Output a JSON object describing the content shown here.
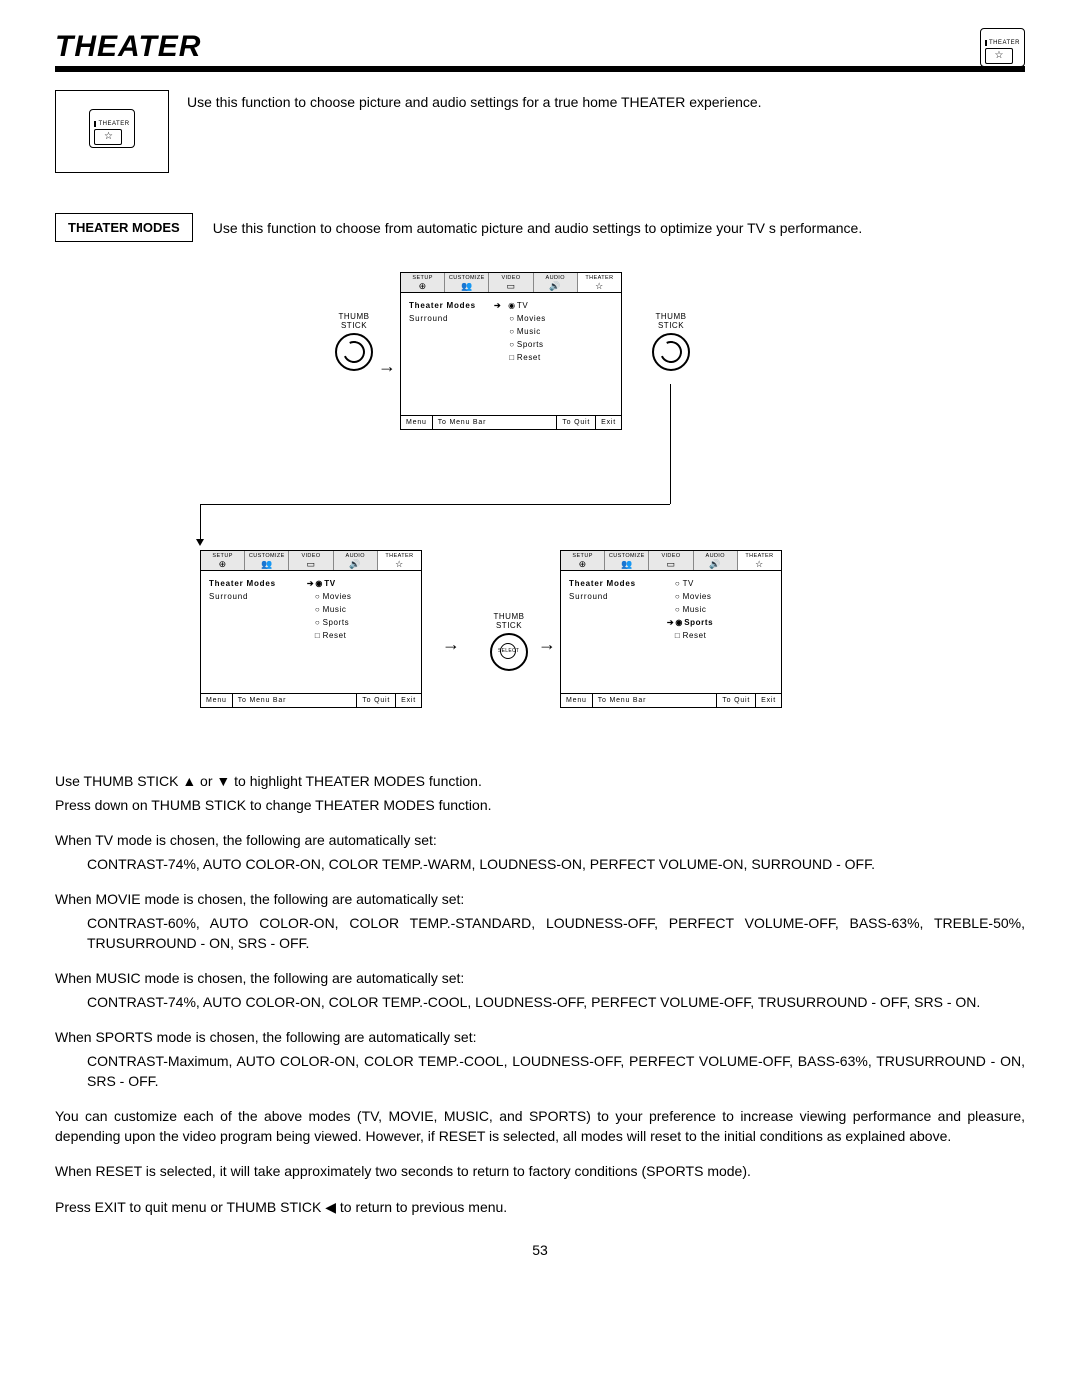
{
  "page_number": "53",
  "title": "THEATER",
  "corner_icon_label": "THEATER",
  "intro_text": "Use this function to choose picture and audio settings for a true home THEATER experience.",
  "section_label": "THEATER MODES",
  "section_text": "Use this function to choose from automatic picture and audio settings to optimize your TV s performance.",
  "thumbstick_label": "THUMB\nSTICK",
  "select_label": "SELECT",
  "tabs": [
    "SETUP",
    "CUSTOMIZE",
    "VIDEO",
    "AUDIO",
    "THEATER"
  ],
  "tab_icons": [
    "⊕",
    "👥",
    "▭",
    "🔊",
    "☆"
  ],
  "menu_left": {
    "item1": "Theater Modes",
    "item2": "Surround"
  },
  "options": {
    "tv": "TV",
    "movies": "Movies",
    "music": "Music",
    "sports": "Sports",
    "reset": "Reset"
  },
  "footer": {
    "menu": "Menu",
    "to_menu_bar": "To Menu Bar",
    "to_quit": "To Quit",
    "exit": "Exit"
  },
  "body": {
    "p1": "Use THUMB STICK ▲ or ▼ to highlight THEATER  MODES function.",
    "p2": "Press down on THUMB STICK to change THEATER MODES function.",
    "tv_head": "When TV mode is chosen, the following are automatically set:",
    "tv_body": "CONTRAST-74%, AUTO COLOR-ON, COLOR TEMP.-WARM, LOUDNESS-ON, PERFECT VOLUME-ON, SURROUND - OFF.",
    "movie_head": "When MOVIE mode is chosen, the following are automatically set:",
    "movie_body": "CONTRAST-60%, AUTO COLOR-ON, COLOR TEMP.-STANDARD, LOUDNESS-OFF, PERFECT VOLUME-OFF, BASS-63%, TREBLE-50%, TRUSURROUND - ON, SRS - OFF.",
    "music_head": "When MUSIC mode is chosen, the following are automatically set:",
    "music_body": "CONTRAST-74%, AUTO COLOR-ON, COLOR TEMP.-COOL, LOUDNESS-OFF, PERFECT VOLUME-OFF, TRUSURROUND - OFF, SRS - ON.",
    "sports_head": "When SPORTS mode is chosen, the following are automatically set:",
    "sports_body": "CONTRAST-Maximum, AUTO COLOR-ON, COLOR TEMP.-COOL, LOUDNESS-OFF, PERFECT VOLUME-OFF, BASS-63%, TRUSURROUND - ON, SRS - OFF.",
    "customize": "You can customize each of the above modes (TV, MOVIE, MUSIC, and SPORTS) to your preference to increase viewing performance and pleasure, depending upon the video program being viewed. However, if RESET is selected, all modes will reset to the initial conditions as explained above.",
    "reset": "When RESET is selected, it will take approximately two seconds to return to factory conditions (SPORTS mode).",
    "exit": "Press EXIT to quit menu or THUMB STICK ◀ to return to previous menu."
  }
}
